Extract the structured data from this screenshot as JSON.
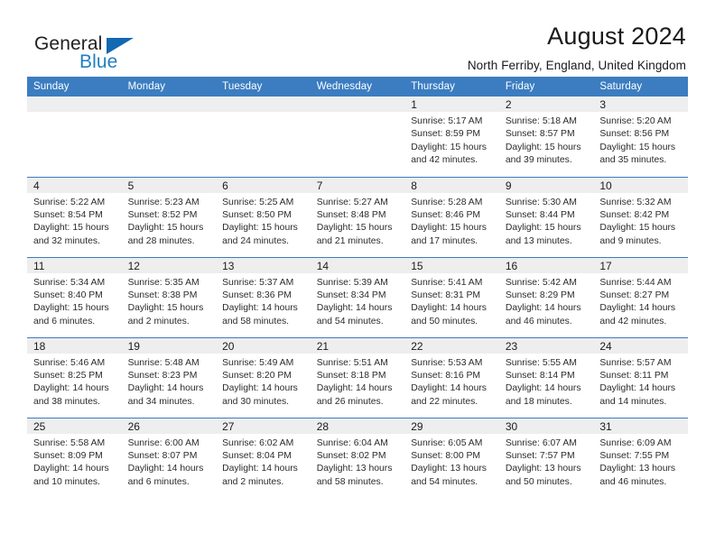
{
  "brand": {
    "name_part1": "General",
    "name_part2": "Blue",
    "logo_icon": "blue-triangle-logo"
  },
  "header": {
    "title": "August 2024",
    "subtitle": "North Ferriby, England, United Kingdom"
  },
  "weekday_headers": [
    "Sunday",
    "Monday",
    "Tuesday",
    "Wednesday",
    "Thursday",
    "Friday",
    "Saturday"
  ],
  "colors": {
    "header_blue": "#3b7dc0",
    "brand_blue": "#1f7fc4",
    "daynum_band": "#eeeeee",
    "text": "#1a1a1a"
  },
  "labels": {
    "sunrise_prefix": "Sunrise: ",
    "sunset_prefix": "Sunset: ",
    "daylight_prefix": "Daylight: "
  },
  "weeks": [
    [
      {
        "day": "",
        "empty": true
      },
      {
        "day": "",
        "empty": true
      },
      {
        "day": "",
        "empty": true
      },
      {
        "day": "",
        "empty": true
      },
      {
        "day": "1",
        "sunrise": "Sunrise: 5:17 AM",
        "sunset": "Sunset: 8:59 PM",
        "daylight_line1": "Daylight: 15 hours",
        "daylight_line2": "and 42 minutes."
      },
      {
        "day": "2",
        "sunrise": "Sunrise: 5:18 AM",
        "sunset": "Sunset: 8:57 PM",
        "daylight_line1": "Daylight: 15 hours",
        "daylight_line2": "and 39 minutes."
      },
      {
        "day": "3",
        "sunrise": "Sunrise: 5:20 AM",
        "sunset": "Sunset: 8:56 PM",
        "daylight_line1": "Daylight: 15 hours",
        "daylight_line2": "and 35 minutes."
      }
    ],
    [
      {
        "day": "4",
        "sunrise": "Sunrise: 5:22 AM",
        "sunset": "Sunset: 8:54 PM",
        "daylight_line1": "Daylight: 15 hours",
        "daylight_line2": "and 32 minutes."
      },
      {
        "day": "5",
        "sunrise": "Sunrise: 5:23 AM",
        "sunset": "Sunset: 8:52 PM",
        "daylight_line1": "Daylight: 15 hours",
        "daylight_line2": "and 28 minutes."
      },
      {
        "day": "6",
        "sunrise": "Sunrise: 5:25 AM",
        "sunset": "Sunset: 8:50 PM",
        "daylight_line1": "Daylight: 15 hours",
        "daylight_line2": "and 24 minutes."
      },
      {
        "day": "7",
        "sunrise": "Sunrise: 5:27 AM",
        "sunset": "Sunset: 8:48 PM",
        "daylight_line1": "Daylight: 15 hours",
        "daylight_line2": "and 21 minutes."
      },
      {
        "day": "8",
        "sunrise": "Sunrise: 5:28 AM",
        "sunset": "Sunset: 8:46 PM",
        "daylight_line1": "Daylight: 15 hours",
        "daylight_line2": "and 17 minutes."
      },
      {
        "day": "9",
        "sunrise": "Sunrise: 5:30 AM",
        "sunset": "Sunset: 8:44 PM",
        "daylight_line1": "Daylight: 15 hours",
        "daylight_line2": "and 13 minutes."
      },
      {
        "day": "10",
        "sunrise": "Sunrise: 5:32 AM",
        "sunset": "Sunset: 8:42 PM",
        "daylight_line1": "Daylight: 15 hours",
        "daylight_line2": "and 9 minutes."
      }
    ],
    [
      {
        "day": "11",
        "sunrise": "Sunrise: 5:34 AM",
        "sunset": "Sunset: 8:40 PM",
        "daylight_line1": "Daylight: 15 hours",
        "daylight_line2": "and 6 minutes."
      },
      {
        "day": "12",
        "sunrise": "Sunrise: 5:35 AM",
        "sunset": "Sunset: 8:38 PM",
        "daylight_line1": "Daylight: 15 hours",
        "daylight_line2": "and 2 minutes."
      },
      {
        "day": "13",
        "sunrise": "Sunrise: 5:37 AM",
        "sunset": "Sunset: 8:36 PM",
        "daylight_line1": "Daylight: 14 hours",
        "daylight_line2": "and 58 minutes."
      },
      {
        "day": "14",
        "sunrise": "Sunrise: 5:39 AM",
        "sunset": "Sunset: 8:34 PM",
        "daylight_line1": "Daylight: 14 hours",
        "daylight_line2": "and 54 minutes."
      },
      {
        "day": "15",
        "sunrise": "Sunrise: 5:41 AM",
        "sunset": "Sunset: 8:31 PM",
        "daylight_line1": "Daylight: 14 hours",
        "daylight_line2": "and 50 minutes."
      },
      {
        "day": "16",
        "sunrise": "Sunrise: 5:42 AM",
        "sunset": "Sunset: 8:29 PM",
        "daylight_line1": "Daylight: 14 hours",
        "daylight_line2": "and 46 minutes."
      },
      {
        "day": "17",
        "sunrise": "Sunrise: 5:44 AM",
        "sunset": "Sunset: 8:27 PM",
        "daylight_line1": "Daylight: 14 hours",
        "daylight_line2": "and 42 minutes."
      }
    ],
    [
      {
        "day": "18",
        "sunrise": "Sunrise: 5:46 AM",
        "sunset": "Sunset: 8:25 PM",
        "daylight_line1": "Daylight: 14 hours",
        "daylight_line2": "and 38 minutes."
      },
      {
        "day": "19",
        "sunrise": "Sunrise: 5:48 AM",
        "sunset": "Sunset: 8:23 PM",
        "daylight_line1": "Daylight: 14 hours",
        "daylight_line2": "and 34 minutes."
      },
      {
        "day": "20",
        "sunrise": "Sunrise: 5:49 AM",
        "sunset": "Sunset: 8:20 PM",
        "daylight_line1": "Daylight: 14 hours",
        "daylight_line2": "and 30 minutes."
      },
      {
        "day": "21",
        "sunrise": "Sunrise: 5:51 AM",
        "sunset": "Sunset: 8:18 PM",
        "daylight_line1": "Daylight: 14 hours",
        "daylight_line2": "and 26 minutes."
      },
      {
        "day": "22",
        "sunrise": "Sunrise: 5:53 AM",
        "sunset": "Sunset: 8:16 PM",
        "daylight_line1": "Daylight: 14 hours",
        "daylight_line2": "and 22 minutes."
      },
      {
        "day": "23",
        "sunrise": "Sunrise: 5:55 AM",
        "sunset": "Sunset: 8:14 PM",
        "daylight_line1": "Daylight: 14 hours",
        "daylight_line2": "and 18 minutes."
      },
      {
        "day": "24",
        "sunrise": "Sunrise: 5:57 AM",
        "sunset": "Sunset: 8:11 PM",
        "daylight_line1": "Daylight: 14 hours",
        "daylight_line2": "and 14 minutes."
      }
    ],
    [
      {
        "day": "25",
        "sunrise": "Sunrise: 5:58 AM",
        "sunset": "Sunset: 8:09 PM",
        "daylight_line1": "Daylight: 14 hours",
        "daylight_line2": "and 10 minutes."
      },
      {
        "day": "26",
        "sunrise": "Sunrise: 6:00 AM",
        "sunset": "Sunset: 8:07 PM",
        "daylight_line1": "Daylight: 14 hours",
        "daylight_line2": "and 6 minutes."
      },
      {
        "day": "27",
        "sunrise": "Sunrise: 6:02 AM",
        "sunset": "Sunset: 8:04 PM",
        "daylight_line1": "Daylight: 14 hours",
        "daylight_line2": "and 2 minutes."
      },
      {
        "day": "28",
        "sunrise": "Sunrise: 6:04 AM",
        "sunset": "Sunset: 8:02 PM",
        "daylight_line1": "Daylight: 13 hours",
        "daylight_line2": "and 58 minutes."
      },
      {
        "day": "29",
        "sunrise": "Sunrise: 6:05 AM",
        "sunset": "Sunset: 8:00 PM",
        "daylight_line1": "Daylight: 13 hours",
        "daylight_line2": "and 54 minutes."
      },
      {
        "day": "30",
        "sunrise": "Sunrise: 6:07 AM",
        "sunset": "Sunset: 7:57 PM",
        "daylight_line1": "Daylight: 13 hours",
        "daylight_line2": "and 50 minutes."
      },
      {
        "day": "31",
        "sunrise": "Sunrise: 6:09 AM",
        "sunset": "Sunset: 7:55 PM",
        "daylight_line1": "Daylight: 13 hours",
        "daylight_line2": "and 46 minutes."
      }
    ]
  ]
}
